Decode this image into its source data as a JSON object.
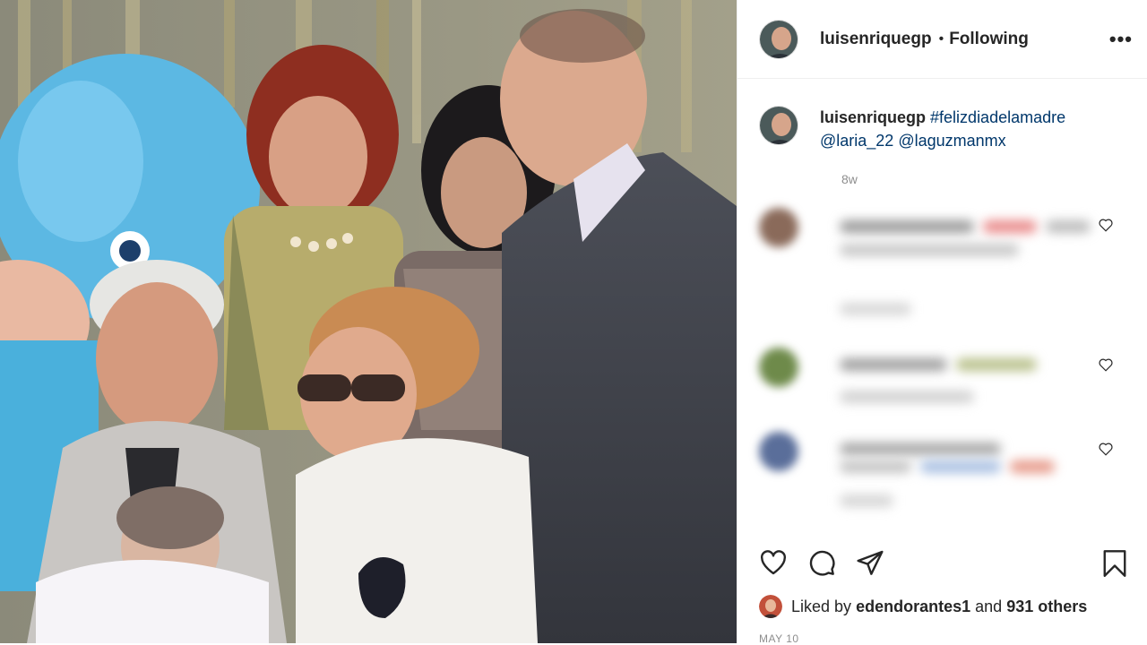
{
  "post": {
    "author": "luisenriquegp",
    "follow_status": "Following",
    "more_icon": "more-horizontal-icon",
    "caption": {
      "username": "luisenriquegp",
      "hashtag": "#felizdiadelamadre",
      "mention1": "@laria_22",
      "mention2": "@laguzmanmx",
      "age": "8w"
    },
    "comments": [
      {
        "blurred": true
      },
      {
        "blurred": true
      },
      {
        "blurred": true
      }
    ],
    "actions": {
      "like_icon": "heart-icon",
      "comment_icon": "comment-icon",
      "share_icon": "share-icon",
      "save_icon": "bookmark-icon"
    },
    "likes": {
      "prefix": "Liked by",
      "user": "edendorantes1",
      "middle": "and",
      "others": "931 others"
    },
    "date": "MAY 10"
  },
  "colors": {
    "link": "#00376b",
    "text": "#262626",
    "muted": "#8e8e8e"
  }
}
